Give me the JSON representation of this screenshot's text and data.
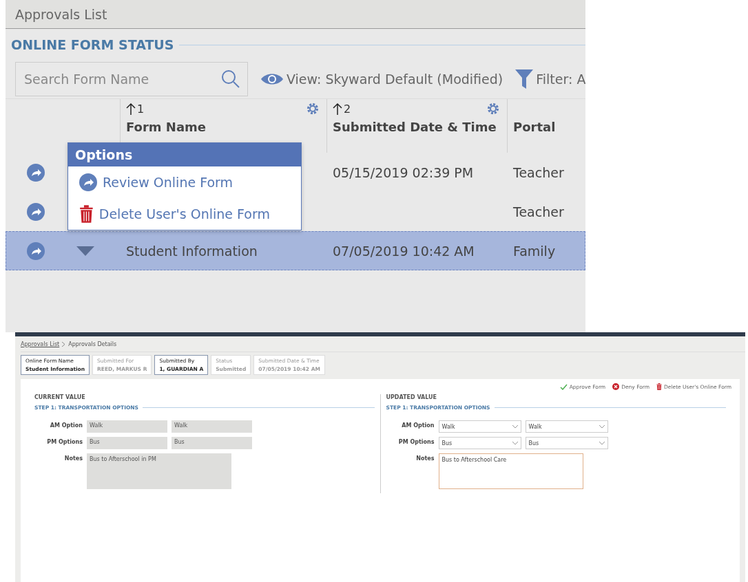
{
  "approvals_list": {
    "title": "Approvals List",
    "section_title": "ONLINE FORM STATUS",
    "search": {
      "placeholder": "Search Form Name"
    },
    "view": "View: Skyward Default (Modified)",
    "filter": "Filter: A",
    "columns": [
      {
        "sort": "1",
        "label": "Form Name",
        "gear": true
      },
      {
        "sort": "2",
        "label": "Submitted Date & Time",
        "gear": true
      },
      {
        "label": "Portal",
        "gear": false
      }
    ],
    "rows": [
      {
        "form_name": "",
        "date": "05/15/2019 02:39 PM",
        "portal": "Teacher",
        "selected": false
      },
      {
        "form_name": "",
        "date": "",
        "portal": "Teacher",
        "selected": false
      },
      {
        "form_name": "Student Information",
        "date": "07/05/2019 10:42 AM",
        "portal": "Family",
        "selected": true
      }
    ],
    "options_menu": {
      "title": "Options",
      "items": [
        {
          "kind": "review",
          "label": "Review Online Form"
        },
        {
          "kind": "delete",
          "label": "Delete User's Online Form"
        }
      ]
    }
  },
  "approvals_details": {
    "breadcrumb": [
      {
        "label": "Approvals List",
        "link": true
      },
      {
        "label": "Approvals Details",
        "link": false
      }
    ],
    "summary": [
      {
        "label": "Online Form Name",
        "value": "Student Information",
        "selected": true
      },
      {
        "label": "Submitted For",
        "value": "REED, MARKUS R",
        "selected": false
      },
      {
        "label": "Submitted By",
        "value": "1, GUARDIAN A",
        "selected": true
      },
      {
        "label": "Status",
        "value": "Submitted",
        "selected": false
      },
      {
        "label": "Submitted Date & Time",
        "value": "07/05/2019 10:42 AM",
        "selected": false
      }
    ],
    "actions": [
      {
        "kind": "approve",
        "label": "Approve Form"
      },
      {
        "kind": "deny",
        "label": "Deny Form"
      },
      {
        "kind": "delete",
        "label": "Delete User's Online Form"
      }
    ],
    "panels": [
      {
        "kind": "readonly",
        "title": "CURRENT VALUE",
        "step": "STEP 1: TRANSPORTATION OPTIONS",
        "fields": [
          {
            "label": "AM Option",
            "values": [
              "Walk",
              "Walk"
            ]
          },
          {
            "label": "PM Options",
            "values": [
              "Bus",
              "Bus"
            ]
          }
        ],
        "notes_label": "Notes",
        "notes": "Bus to Afterschool in PM"
      },
      {
        "kind": "editable",
        "title": "UPDATED VALUE",
        "step": "STEP 1: TRANSPORTATION OPTIONS",
        "fields": [
          {
            "label": "AM Option",
            "values": [
              "Walk",
              "Walk"
            ]
          },
          {
            "label": "PM Options",
            "values": [
              "Bus",
              "Bus"
            ]
          }
        ],
        "notes_label": "Notes",
        "notes": "Bus to Afterschool Care"
      }
    ]
  }
}
